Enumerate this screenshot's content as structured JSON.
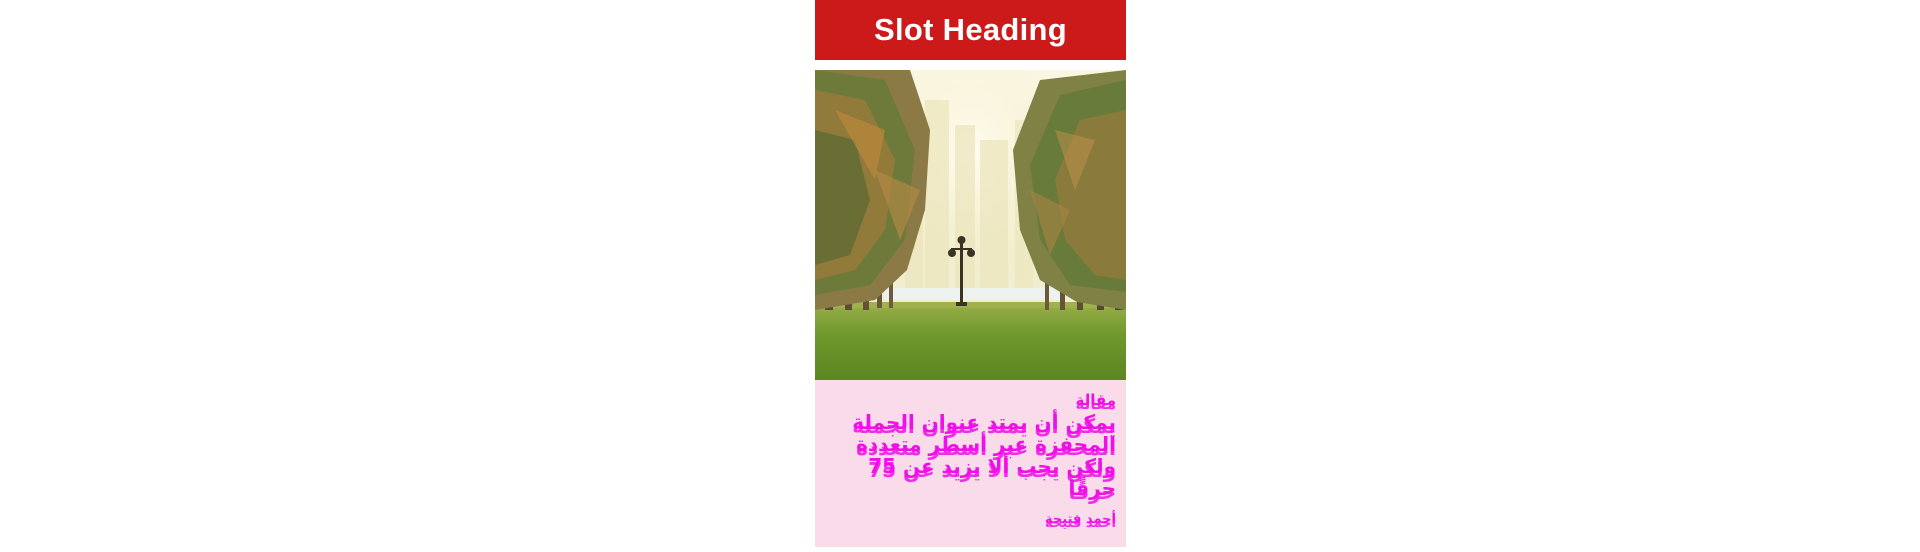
{
  "slot": {
    "heading": "Slot Heading",
    "caption": {
      "label": "مقالة",
      "title": "يمكن أن يمتد عنوان الجملة المحفزة عبر أسطر متعددة ولكن يجب ألا يزيد عن 75 حرفًا",
      "author": "أحمد فتيحة"
    }
  },
  "colors": {
    "heading_bg": "#cc1a1a",
    "caption_bg": "#f9dbea",
    "caption_text": "#ee10e6"
  }
}
